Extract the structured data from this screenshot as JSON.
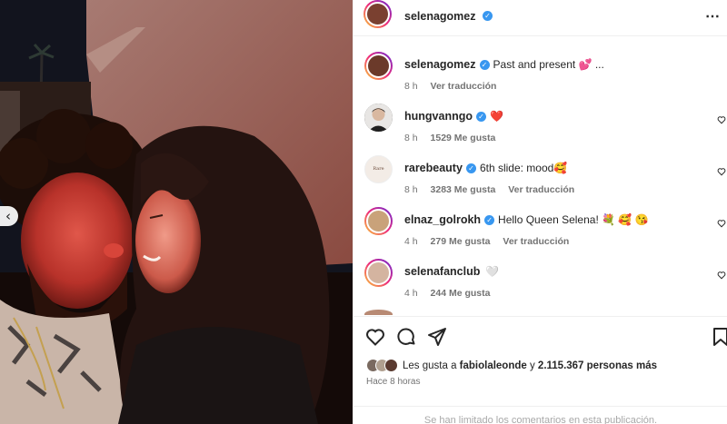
{
  "post": {
    "author": "selenagomez",
    "more_icon": "⋯"
  },
  "comments": [
    {
      "username": "selenagomez",
      "text": "Past and present 💕 ...",
      "time": "8 h",
      "likes": "",
      "translate": "Ver traducción",
      "avatar_color": "#6b3a2a"
    },
    {
      "username": "hungvanngo",
      "text": "❤️",
      "time": "8 h",
      "likes": "1529 Me gusta",
      "translate": "",
      "avatar_color": "#2a2a2a"
    },
    {
      "username": "rarebeauty",
      "text": "6th slide: mood🥰",
      "time": "8 h",
      "likes": "3283 Me gusta",
      "translate": "Ver traducción",
      "avatar_color": "#f3ece6",
      "avatar_text": "Rare Beauty"
    },
    {
      "username": "elnaz_golrokh",
      "text": "Hello Queen Selena! 💐 🥰 😘",
      "time": "4 h",
      "likes": "279 Me gusta",
      "translate": "Ver traducción",
      "avatar_color": "#c9a27a"
    },
    {
      "username": "selenafanclub",
      "text": "🤍",
      "time": "4 h",
      "likes": "244 Me gusta",
      "translate": "",
      "avatar_color": "#d4b4a0"
    }
  ],
  "likes": {
    "prefix": "Les gusta a ",
    "user": "fabiolaleonde",
    "middle": " y ",
    "count": "2.115.367 personas más"
  },
  "time_ago": "Hace 8 horas",
  "limited_text": "Se han limitado los comentarios en esta publicación.",
  "colors": {
    "verified": "#3897f0",
    "heart": "#ed4956",
    "text": "#262626",
    "muted": "#737373"
  }
}
